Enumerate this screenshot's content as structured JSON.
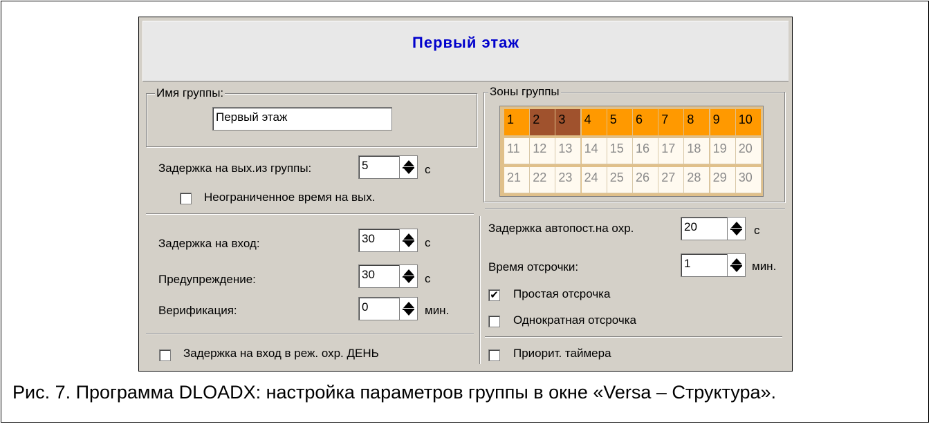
{
  "window": {
    "title": "Первый этаж"
  },
  "group_name": {
    "legend": "Имя группы:",
    "value": "Первый этаж"
  },
  "exit_delay": {
    "label": "Задержка на вых.из группы:",
    "value": "5",
    "unit": "с"
  },
  "unlimited_exit": {
    "label": "Неограниченное время на вых.",
    "checked": false
  },
  "entry_delay": {
    "label": "Задержка на вход:",
    "value": "30",
    "unit": "с"
  },
  "warning": {
    "label": "Предупреждение:",
    "value": "30",
    "unit": "с"
  },
  "verification": {
    "label": "Верификация:",
    "value": "0",
    "unit": "мин."
  },
  "day_entry_delay": {
    "label": "Задержка на вход в реж. охр. ДЕНЬ",
    "checked": false
  },
  "zones": {
    "legend": "Зоны группы",
    "rows": [
      [
        "1",
        "2",
        "3",
        "4",
        "5",
        "6",
        "7",
        "8",
        "9",
        "10"
      ],
      [
        "11",
        "12",
        "13",
        "14",
        "15",
        "16",
        "17",
        "18",
        "19",
        "20"
      ],
      [
        "21",
        "22",
        "23",
        "24",
        "25",
        "26",
        "27",
        "28",
        "29",
        "30"
      ]
    ],
    "highlighted": [
      "1",
      "4",
      "5",
      "6",
      "7",
      "8",
      "9",
      "10"
    ],
    "dark": [
      "2",
      "3"
    ],
    "colors": {
      "on": "#ff9900",
      "dark": "#a0522d",
      "off": "#fffaf0"
    }
  },
  "auto_arm_delay": {
    "label": "Задержка автопост.на охр.",
    "value": "20",
    "unit": "с"
  },
  "defer_time": {
    "label": "Время отсрочки:",
    "value": "1",
    "unit": "мин."
  },
  "simple_defer": {
    "label": "Простая отсрочка",
    "checked": true
  },
  "single_defer": {
    "label": "Однократная отсрочка",
    "checked": false
  },
  "timer_priority": {
    "label": "Приорит. таймера",
    "checked": false
  },
  "caption": "Рис. 7. Программа DLOADX: настройка параметров группы в окне «Versa – Структура»."
}
